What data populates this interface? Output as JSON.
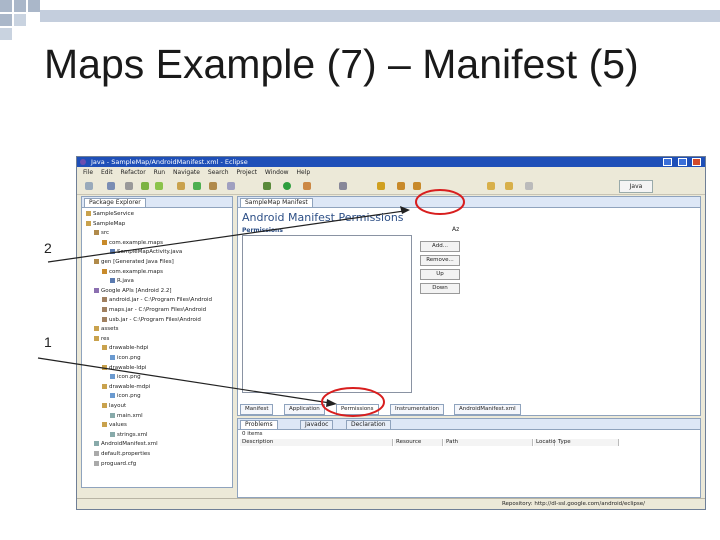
{
  "slide": {
    "title": "Maps Example (7) – Manifest (5)",
    "markers": [
      "2",
      "1"
    ]
  },
  "window": {
    "title": "Java - SampleMap/AndroidManifest.xml - Eclipse",
    "menu": [
      "File",
      "Edit",
      "Refactor",
      "Run",
      "Navigate",
      "Search",
      "Project",
      "Window",
      "Help"
    ],
    "perspective": "Java"
  },
  "package_explorer": {
    "tab_label": "Package Explorer",
    "items": [
      "SampleService",
      "SampleMap",
      "src",
      "com.example.maps",
      "SampleMapActivity.java",
      "gen [Generated Java Files]",
      "com.example.maps",
      "R.java",
      "Google APIs [Android 2.2]",
      "android.jar - C:\\Program Files\\Android",
      "maps.jar - C:\\Program Files\\Android",
      "usb.jar - C:\\Program Files\\Android",
      "assets",
      "res",
      "drawable-hdpi",
      "icon.png",
      "drawable-ldpi",
      "icon.png",
      "drawable-mdpi",
      "icon.png",
      "layout",
      "main.xml",
      "values",
      "strings.xml",
      "AndroidManifest.xml",
      "default.properties",
      "proguard.cfg"
    ]
  },
  "editor": {
    "tab_label": "SampleMap Manifest",
    "heading": "Android Manifest Permissions",
    "permissions_label": "Permissions",
    "buttons": [
      "Add...",
      "Remove...",
      "Up",
      "Down"
    ],
    "bottom_tabs": [
      "Manifest",
      "Application",
      "Permissions",
      "Instrumentation",
      "AndroidManifest.xml"
    ]
  },
  "problems": {
    "tabs": [
      "Problems",
      "Javadoc",
      "Declaration"
    ],
    "summary": "0 items",
    "columns": [
      "Description",
      "Resource",
      "Path",
      "Location",
      "Type"
    ]
  },
  "status_bar": {
    "text": "Repository: http://dl-ssl.google.com/android/eclipse/"
  },
  "colors": {
    "title_bar": "#1e4fb8",
    "highlight_circle": "#d81e1e",
    "deco_square": "#aab7c9"
  }
}
